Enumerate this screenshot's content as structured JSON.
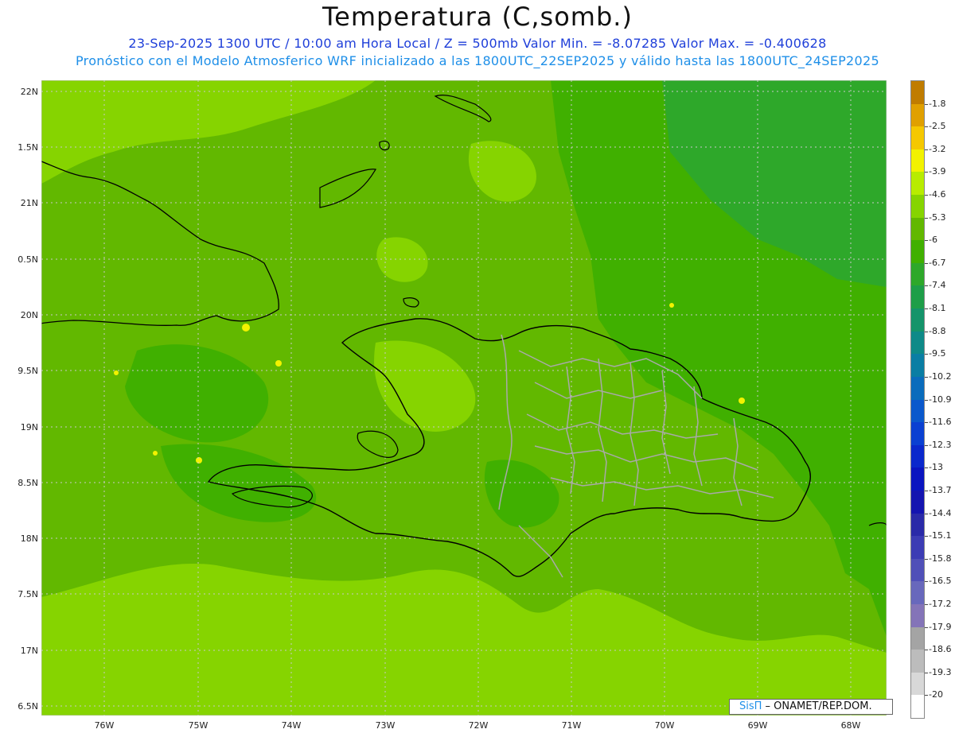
{
  "title": "Temperatura (C,somb.)",
  "subtitle_line1": "23-Sep-2025  1300 UTC / 10:00 am Hora Local / Z = 500mb Valor Min. = -8.07285  Valor Max. = -0.400628",
  "subtitle_line2": "Pronóstico con el Modelo Atmosferico WRF inicializado a las 1800UTC_22SEP2025 y válido hasta las  1800UTC_24SEP2025",
  "credit": {
    "brand": "SisΠ",
    "text": " – ONAMET/REP.DOM."
  },
  "lat_labels": [
    "22N",
    "1.5N",
    "21N",
    "0.5N",
    "20N",
    "9.5N",
    "19N",
    "8.5N",
    "18N",
    "7.5N",
    "17N",
    "6.5N"
  ],
  "lon_labels": [
    "76W",
    "75W",
    "74W",
    "73W",
    "72W",
    "71W",
    "70W",
    "69W",
    "68W"
  ],
  "colorbar": {
    "labels": [
      "-1.8",
      "-2.5",
      "-3.2",
      "-3.9",
      "-4.6",
      "-5.3",
      "-6",
      "-6.7",
      "-7.4",
      "-8.1",
      "-8.8",
      "-9.5",
      "-10.2",
      "-10.9",
      "-11.6",
      "-12.3",
      "-13",
      "-13.7",
      "-14.4",
      "-15.1",
      "-15.8",
      "-16.5",
      "-17.2",
      "-17.9",
      "-18.6",
      "-19.3",
      "-20"
    ],
    "colors": [
      "#c07c00",
      "#e0a000",
      "#f5c800",
      "#f2f200",
      "#b8ec00",
      "#86d400",
      "#62b800",
      "#40b000",
      "#2ea82a",
      "#1e9e48",
      "#14946a",
      "#0e8a88",
      "#0a7ea4",
      "#0a6cbc",
      "#0a58cc",
      "#0a40d2",
      "#0a28cc",
      "#0a14c0",
      "#1414b0",
      "#2a2aa8",
      "#3c3cb4",
      "#5050b8",
      "#6868bc",
      "#8474b8",
      "#a4a4a4",
      "#bcbcbc",
      "#d8d8d8",
      "#ffffff"
    ]
  },
  "map_colors": {
    "level_-5.3": "#86d400",
    "level_-6": "#62b800",
    "level_-6.7": "#40b000",
    "level_-7.4": "#2ea82a",
    "level_-3.9": "#f2f200",
    "coastline": "#000000",
    "provinces": "#a9a9a9"
  }
}
